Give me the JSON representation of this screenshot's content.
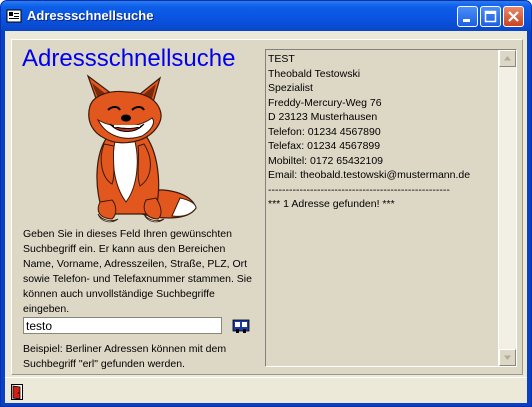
{
  "window": {
    "title": "Adressschnellsuche",
    "icon": "app-icon",
    "controls": [
      "minimize-icon",
      "maximize-icon",
      "close-icon"
    ]
  },
  "main": {
    "heading": "Adressschnellsuche",
    "mascot": "fox-icon",
    "help_text": "Geben Sie in dieses Feld Ihren gewünschten Suchbegriff ein. Er kann aus den Bereichen Name, Vorname, Adresszeilen, Straße, PLZ, Ort sowie Telefon- und Telefaxnummer stammen. Sie können auch unvollständige Suchbegriffe eingeben.",
    "search_value": "testo",
    "search_button_icon": "address-search-icon",
    "example_text": "Beispiel: Berliner Adressen können mit dem Suchbegriff \"erl\" gefunden werden."
  },
  "results": {
    "lines": [
      "TEST",
      "Theobald Testowski",
      "Spezialist",
      "Freddy-Mercury-Weg 76",
      "D 23123 Musterhausen",
      "Telefon: 01234 4567890",
      "Telefax: 01234 4567899",
      "Mobiltel: 0172 65432109",
      "Email: theobald.testowski@mustermann.de",
      "----------------------------------------------------",
      "*** 1 Adresse gefunden! ***"
    ]
  },
  "statusbar": {
    "exit_icon": "exit-door-icon"
  }
}
